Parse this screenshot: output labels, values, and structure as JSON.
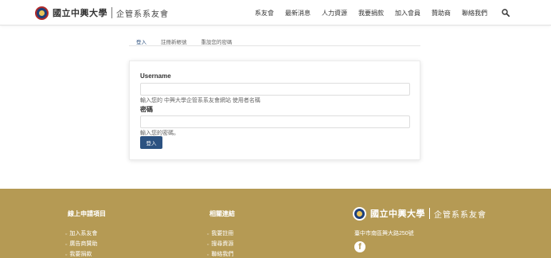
{
  "header": {
    "logo_university": "國立中興大學",
    "logo_department": "企管系系友會",
    "nav": [
      "系友會",
      "最新消息",
      "人力資源",
      "我要捐款",
      "加入會員",
      "贊助商",
      "聯絡我們"
    ],
    "search_icon": "search-icon"
  },
  "tabs": [
    "登入",
    "註冊新帳號",
    "重設您的密碼"
  ],
  "form": {
    "username_label": "Username",
    "username_value": "",
    "username_help": "輸入您的 中興大學企管系系友會網站 使用者名稱",
    "password_label": "密碼",
    "password_value": "",
    "password_help": "輸入您的密碼。",
    "submit_label": "登入"
  },
  "footer": {
    "col1_title": "線上申請項目",
    "col1_links": [
      "加入系友會",
      "廣告商贊助",
      "我要捐款"
    ],
    "col2_title": "相關連結",
    "col2_links": [
      "我要註冊",
      "搜尋資源",
      "聯絡我們"
    ],
    "logo_university": "國立中興大學",
    "logo_department": "企管系系友會",
    "address": "臺中市南區興大路250號",
    "social_icon": "facebook-icon"
  },
  "colors": {
    "accent": "#2c5281",
    "footer_bg": "#b59a54"
  }
}
